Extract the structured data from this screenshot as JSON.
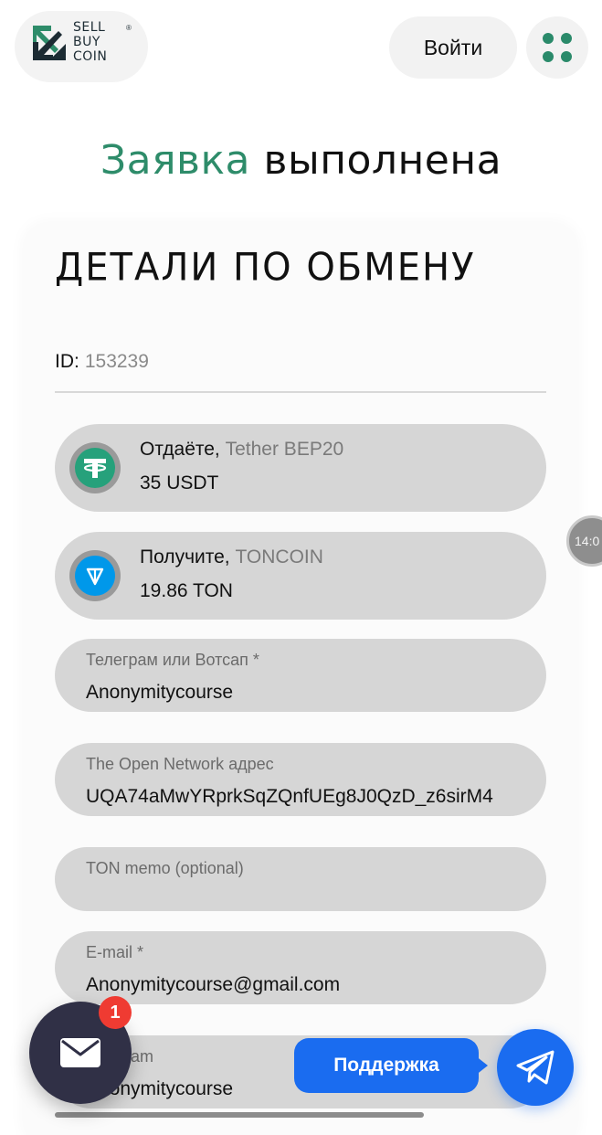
{
  "header": {
    "logo": {
      "line1": "SELL",
      "line2": "BUY",
      "line3": "COIN",
      "reg": "®"
    },
    "login_label": "Войти",
    "menu_icon": "grid-dots-icon"
  },
  "page_title": {
    "accent": "Заявка",
    "rest": "выполнена"
  },
  "details": {
    "title": "ДЕТАЛИ ПО ОБМЕНУ",
    "id_label": "ID:",
    "id_value": "153239"
  },
  "give": {
    "label": "Отдаёте,",
    "coin_name": "Tether BEP20",
    "amount": "35 USDT",
    "icon": "tether-icon",
    "color": "#26a17b"
  },
  "receive": {
    "label": "Получите,",
    "coin_name": "TONCOIN",
    "amount": "19.86 TON",
    "icon": "toncoin-icon",
    "color": "#0098ea"
  },
  "fields": [
    {
      "label": "Телеграм или Вотсап *",
      "value": "Anonymitycourse"
    },
    {
      "label": "The Open Network адрес",
      "value": "UQA74aMwYRprkSqZQnfUEg8J0QzD_z6sirM4"
    },
    {
      "label": "TON memo (optional)",
      "value": ""
    },
    {
      "label": "E-mail *",
      "value": "Anonymitycourse@gmail.com"
    },
    {
      "label": "Telegram",
      "value": "Anonymitycourse"
    }
  ],
  "side_badge": "14:0",
  "mail_widget": {
    "badge_count": "1",
    "icon": "envelope-icon"
  },
  "support": {
    "label": "Поддержка",
    "icon": "telegram-plane-icon",
    "color": "#1a6cf0"
  },
  "colors": {
    "accent": "#2e8c6a",
    "pill_bg": "#d6d6d6"
  }
}
